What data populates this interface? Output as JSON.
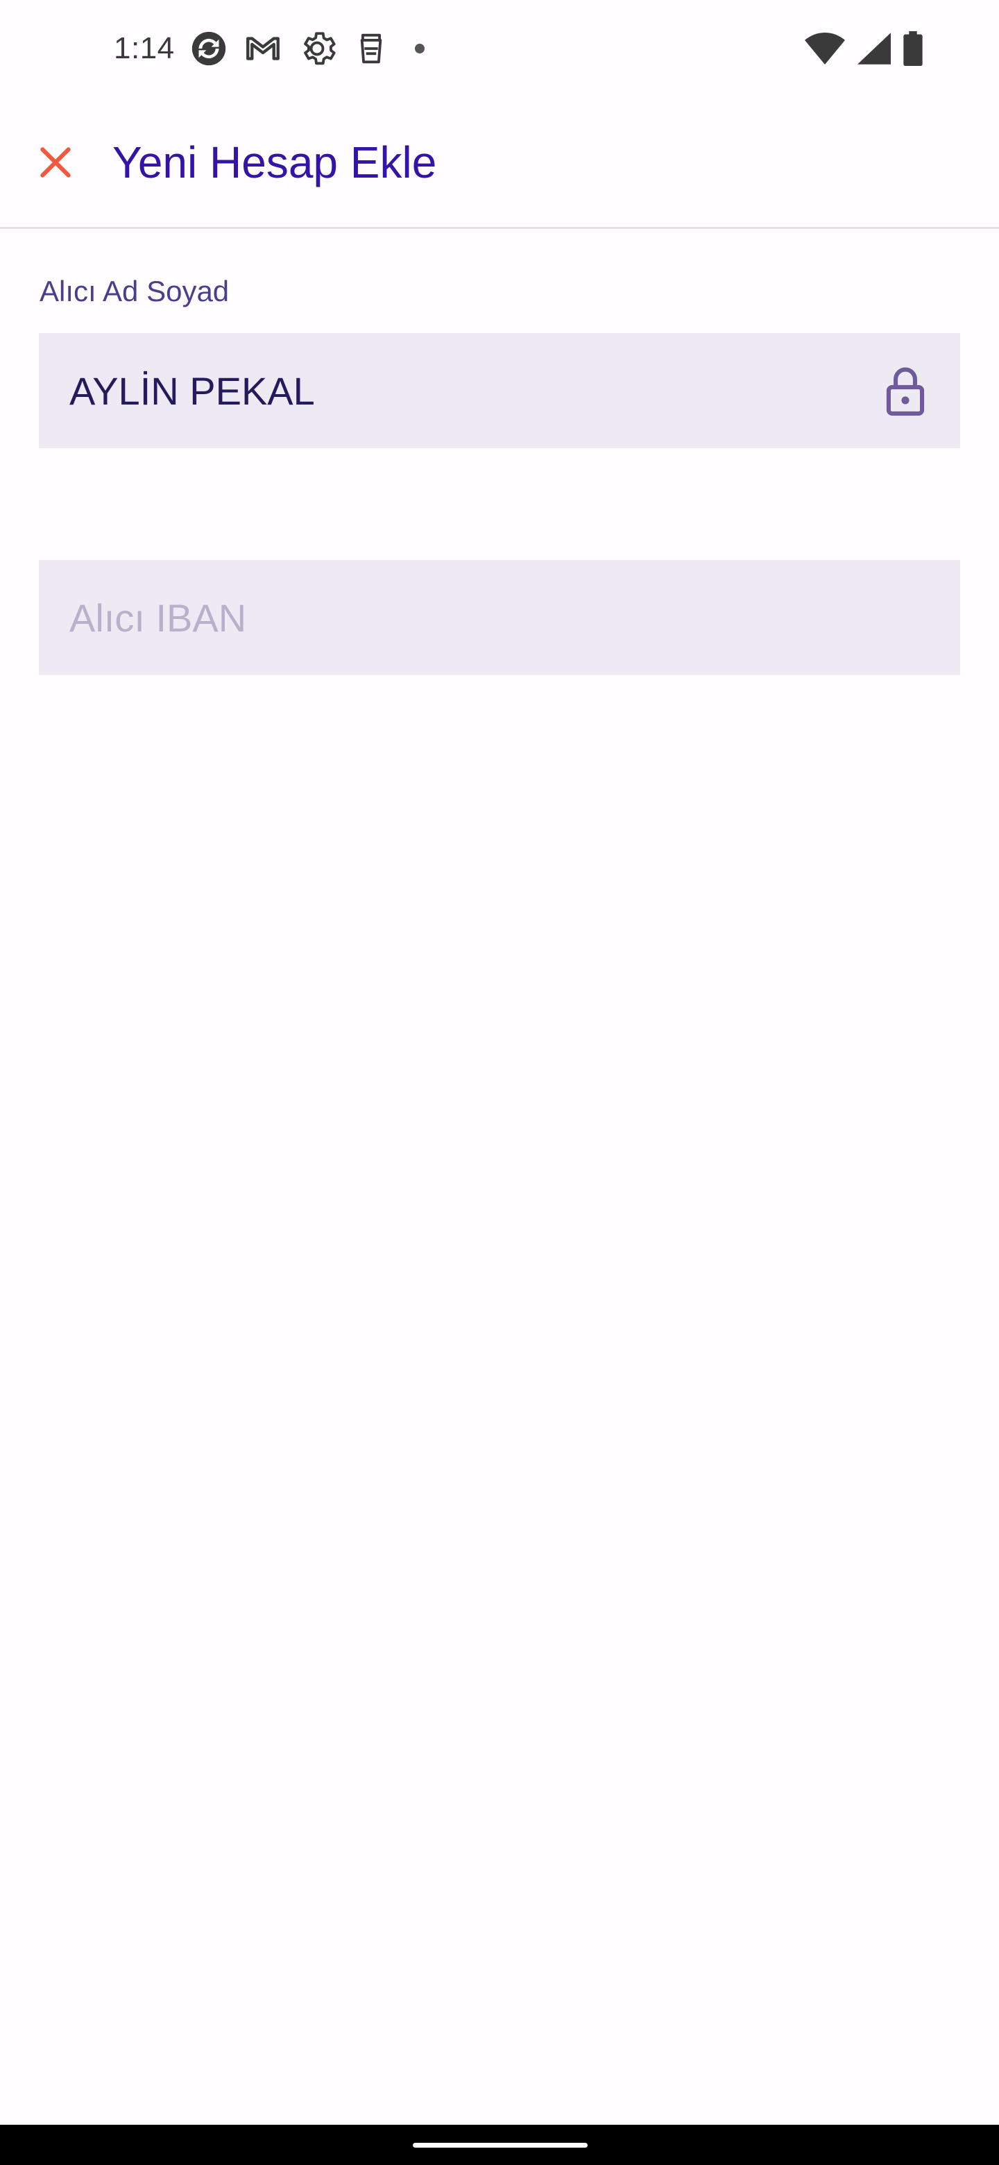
{
  "status_bar": {
    "time": "1:14",
    "notification_icons": [
      "sync-icon",
      "gmail-icon",
      "settings-gear-icon",
      "sim-toolkit-icon",
      "more-dot-icon"
    ],
    "right_icons": [
      "wifi-icon",
      "cell-signal-icon",
      "battery-icon"
    ]
  },
  "app_bar": {
    "close_icon": "close-icon",
    "title": "Yeni Hesap Ekle"
  },
  "form": {
    "name_field": {
      "label": "Alıcı Ad Soyad",
      "value": "AYLİN PEKAL",
      "icon": "lock-icon",
      "locked": true
    },
    "iban_field": {
      "value": "",
      "placeholder": "Alıcı IBAN"
    }
  },
  "colors": {
    "title": "#3414A8",
    "close_icon": "#F05A3C",
    "field_background": "#EEEAF3",
    "label": "#4A3F8C",
    "placeholder": "#B9B1CC",
    "lock_icon": "#6E5A9C"
  }
}
